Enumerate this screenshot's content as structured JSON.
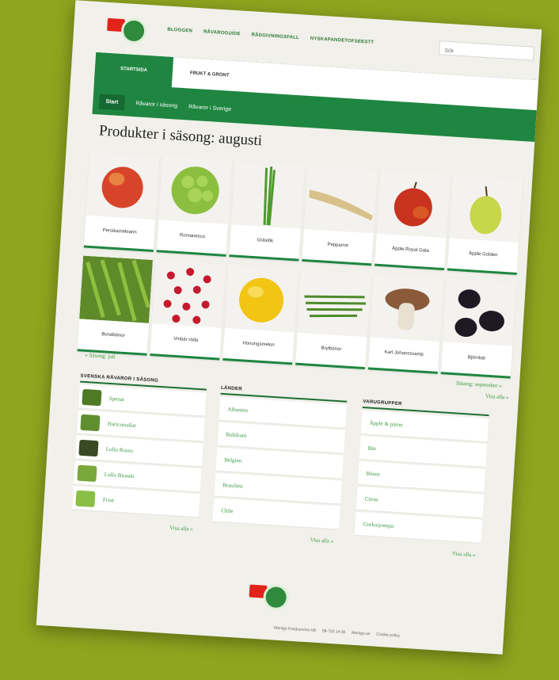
{
  "header": {
    "nav": [
      "BLOGGEN",
      "RÅVAROGUIDE",
      "RÅDGIVNINGSFALL",
      "NYSKAPANDETOFSEESTT"
    ],
    "search_placeholder": "Sök",
    "tabs": {
      "active": "STARTSIDA",
      "second": "FRUKT & GRÖNT"
    },
    "subnav": [
      "Start",
      "Råvaror i säsong",
      "Råvaror i Sverige"
    ]
  },
  "page_title": "Produkter i säsong: augusti",
  "products": [
    {
      "name": "Persika/nektarin",
      "icon": "peach-image"
    },
    {
      "name": "Romanesco",
      "icon": "romanesco-image"
    },
    {
      "name": "Gräslök",
      "icon": "chives-image"
    },
    {
      "name": "Pepparrot",
      "icon": "horseradish-image"
    },
    {
      "name": "Äpple Royal Gala",
      "icon": "red-apple-image"
    },
    {
      "name": "Äpple Golden",
      "icon": "green-apple-image"
    },
    {
      "name": "Bondbönor",
      "icon": "green-beans-image"
    },
    {
      "name": "Vinbär röda",
      "icon": "redcurrant-image"
    },
    {
      "name": "Honungsmelon",
      "icon": "melon-image"
    },
    {
      "name": "Brytbönor",
      "icon": "string-beans-image"
    },
    {
      "name": "Karl Johanssvamp",
      "icon": "mushroom-image"
    },
    {
      "name": "Björnbär",
      "icon": "blackberry-image"
    }
  ],
  "season_nav": {
    "prev": "« Säsong: juli",
    "next": "Säsong: september »",
    "all": "Visa alla »"
  },
  "columns": {
    "swedish": {
      "title": "SVENSKA RÅVAROR I SÄSONG",
      "items": [
        "Spenat",
        "Haricotsallat",
        "Lollo Rosso",
        "Lollo Biondo",
        "Frisé"
      ],
      "view_all": "Visa alla »"
    },
    "countries": {
      "title": "LÄNDER",
      "items": [
        "Albanien",
        "Baltikum",
        "Belgien",
        "Brasilien",
        "Chile"
      ],
      "view_all": "Visa alla »"
    },
    "groups": {
      "title": "VARUGRUPPER",
      "items": [
        "Äpple & päron",
        "Bär",
        "Bönor",
        "Citrus",
        "Gurka/pumpa"
      ],
      "view_all": "Visa alla »"
    }
  },
  "footer": [
    "Menigo Foodservice AB",
    "08-722 14 00",
    "Menigo.se",
    "Cookie policy"
  ],
  "colors": {
    "background": "#8fa51f",
    "brand_green": "#1e8640",
    "brand_red": "#e2231a",
    "link_green": "#3c9a45"
  }
}
